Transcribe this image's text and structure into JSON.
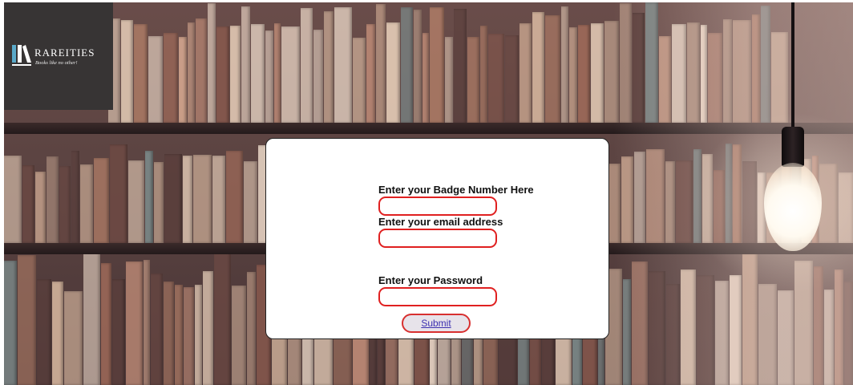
{
  "brand": {
    "name": "RAREITIES",
    "tagline": "Books like no other!"
  },
  "form": {
    "badge_label": "Enter your Badge Number Here",
    "badge_value": "",
    "email_label": "Enter your email address",
    "email_value": "",
    "password_label": "Enter your Password",
    "password_value": "",
    "submit_label": "Submit"
  },
  "colors": {
    "logo_background": "#373434",
    "field_border": "#e02020",
    "submit_text": "#3b2fb0"
  }
}
